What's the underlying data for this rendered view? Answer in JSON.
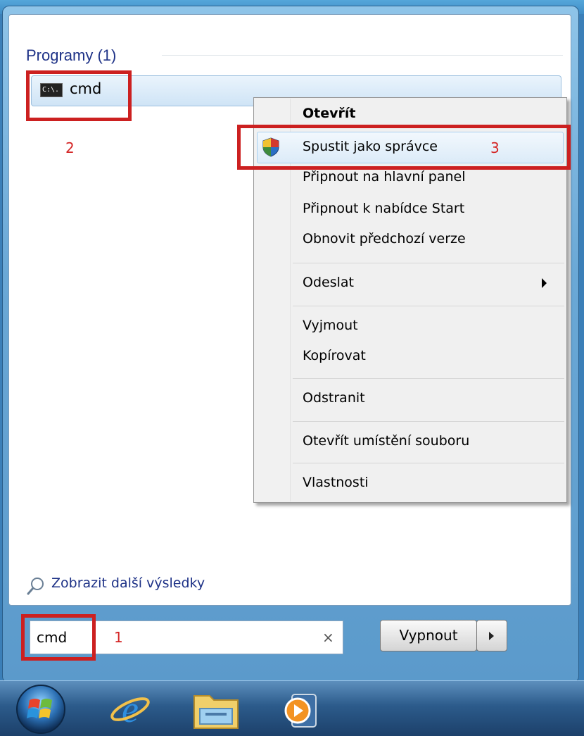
{
  "start_menu": {
    "section_title": "Programy (1)",
    "result_label": "cmd",
    "cmd_icon_text": "C:\\.",
    "more_results": "Zobrazit další výsledky",
    "search_value": "cmd",
    "clear_symbol": "×",
    "shutdown_label": "Vypnout"
  },
  "context_menu": {
    "items": [
      "Otevřít",
      "Spustit jako správce",
      "Připnout na hlavní panel",
      "Připnout k nabídce Start",
      "Obnovit předchozí verze",
      "Odeslat",
      "Vyjmout",
      "Kopírovat",
      "Odstranit",
      "Otevřít umístění souboru",
      "Vlastnosti"
    ]
  },
  "annotations": {
    "step1": "1",
    "step2": "2",
    "step3": "3",
    "highlight_color": "#cc2020"
  },
  "icons": [
    "cmd-icon",
    "shield-icon",
    "submenu-arrow-icon",
    "search-icon",
    "windows-start-icon",
    "internet-explorer-icon",
    "explorer-folder-icon",
    "media-player-icon"
  ]
}
